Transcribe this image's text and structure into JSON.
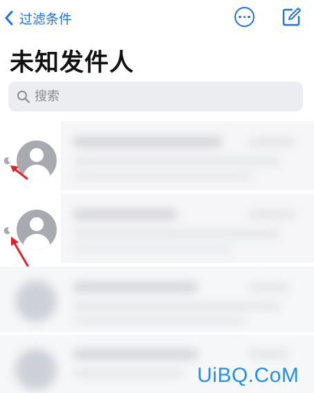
{
  "nav": {
    "back_label": "过滤条件",
    "accent": "#1a72e8"
  },
  "title": "未知发件人",
  "search": {
    "placeholder": "搜索"
  },
  "icons": [
    "chevron-left-icon",
    "more-icon",
    "compose-icon",
    "search-icon",
    "moon-icon",
    "person-icon",
    "red-arrow-icon"
  ],
  "watermark": "UiBQ.CoM"
}
